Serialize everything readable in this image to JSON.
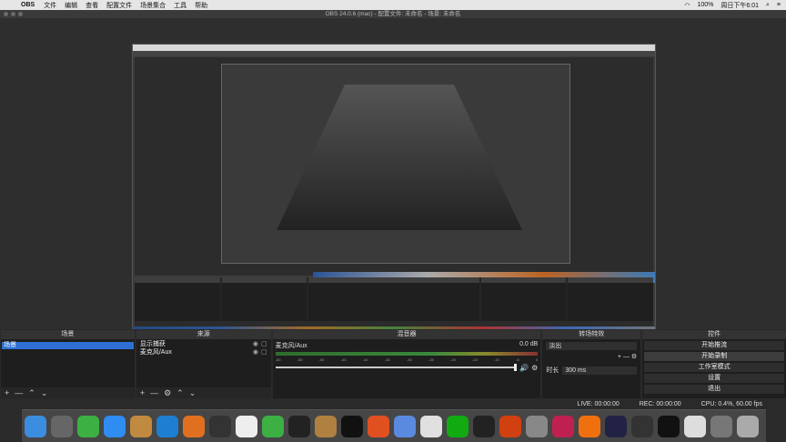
{
  "menubar": {
    "app": "OBS",
    "items": [
      "文件",
      "编辑",
      "查看",
      "配置文件",
      "场景集合",
      "工具",
      "帮助"
    ],
    "battery": "100%",
    "clock": "周日下午6:01"
  },
  "window": {
    "title": "OBS 24.0.6 (mac) - 配置文件: 未命名 - 场景: 未命名"
  },
  "docks": {
    "scenes": {
      "title": "场景",
      "items": [
        "场景"
      ]
    },
    "sources": {
      "title": "来源",
      "items": [
        "显示捕获",
        "麦克风/Aux"
      ]
    },
    "mixer": {
      "title": "混音器",
      "channel": "麦克风/Aux",
      "db": "0.0 dB",
      "scale": [
        "-60",
        "-55",
        "-50",
        "-45",
        "-40",
        "-35",
        "-30",
        "-25",
        "-20",
        "-15",
        "-10",
        "-5",
        "0"
      ]
    },
    "transitions": {
      "title": "转场特效",
      "type": "淡出",
      "duration_label": "时长",
      "duration": "300 ms"
    },
    "controls": {
      "title": "控件",
      "buttons": [
        "开始推流",
        "开始录制",
        "工作室模式",
        "设置",
        "退出"
      ]
    }
  },
  "status": {
    "live": "LIVE: 00:00:00",
    "rec": "REC: 00:00:00",
    "cpu": "CPU: 0.4%, 60.00 fps"
  },
  "dock_apps": [
    "finder",
    "launchpad",
    "facetime",
    "messages",
    "notes",
    "vscode",
    "sublime",
    "terminal",
    "typora",
    "wechat",
    "activity",
    "archive",
    "qq",
    "firefox",
    "preview",
    "chrome",
    "pycharm",
    "obs",
    "xcode",
    "sysprefs",
    "intellij",
    "vlc",
    "quicktime",
    "obs2",
    "screen",
    "textedit",
    "photos",
    "trash"
  ]
}
